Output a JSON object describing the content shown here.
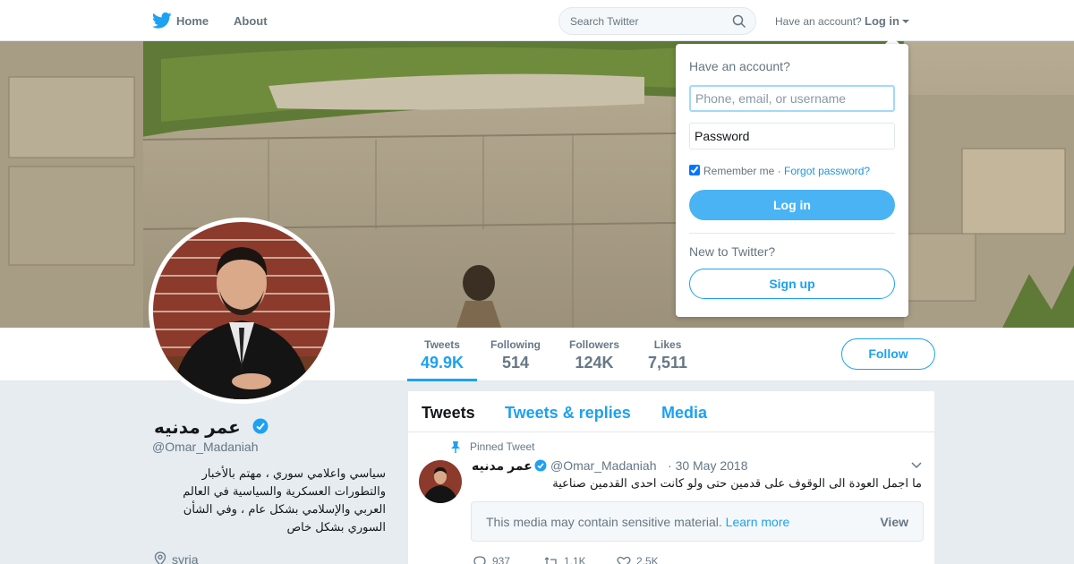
{
  "nav": {
    "home_label": "Home",
    "about_label": "About",
    "search_placeholder": "Search Twitter",
    "have_account": "Have an account?",
    "login_label": "Log in"
  },
  "profile": {
    "name": "عمر مدنيه",
    "handle": "@Omar_Madaniah",
    "bio": "سياسي واعلامي سوري ، مهتم بالأخبار والتطورات العسكرية والسياسية في العالم العربي والإسلامي بشكل عام ، وفي الشأن السوري بشكل خاص",
    "location": "syria",
    "verified": true
  },
  "stats": [
    {
      "label": "Tweets",
      "value": "49.9K",
      "active": true
    },
    {
      "label": "Following",
      "value": "514",
      "active": false
    },
    {
      "label": "Followers",
      "value": "124K",
      "active": false
    },
    {
      "label": "Likes",
      "value": "7,511",
      "active": false
    }
  ],
  "follow_label": "Follow",
  "timeline": {
    "tabs": [
      "Tweets",
      "Tweets & replies",
      "Media"
    ],
    "active_tab": 0,
    "pinned_label": "Pinned Tweet",
    "tweet": {
      "name": "عمر مدنيه",
      "handle": "@Omar_Madaniah",
      "separator": "·",
      "date": "30 May 2018",
      "text": "ما اجمل العودة الى الوقوف على قدمين حتى ولو كانت احدى القدمين صناعية",
      "sensitive_text": "This media may contain sensitive material.",
      "learn_more": "Learn more",
      "view_label": "View",
      "replies": "937",
      "retweets": "1.1K",
      "likes": "2.5K"
    }
  },
  "login_dropdown": {
    "title": "Have an account?",
    "username_placeholder": "Phone, email, or username",
    "password_placeholder": "Password",
    "remember_label": "Remember me",
    "separator": "·",
    "forgot_label": "Forgot password?",
    "remember_checked": true,
    "login_button": "Log in",
    "new_label": "New to Twitter?",
    "signup_button": "Sign up"
  },
  "colors": {
    "accent": "#1da1f2",
    "background": "#e6ecf0",
    "text_secondary": "#657786"
  }
}
